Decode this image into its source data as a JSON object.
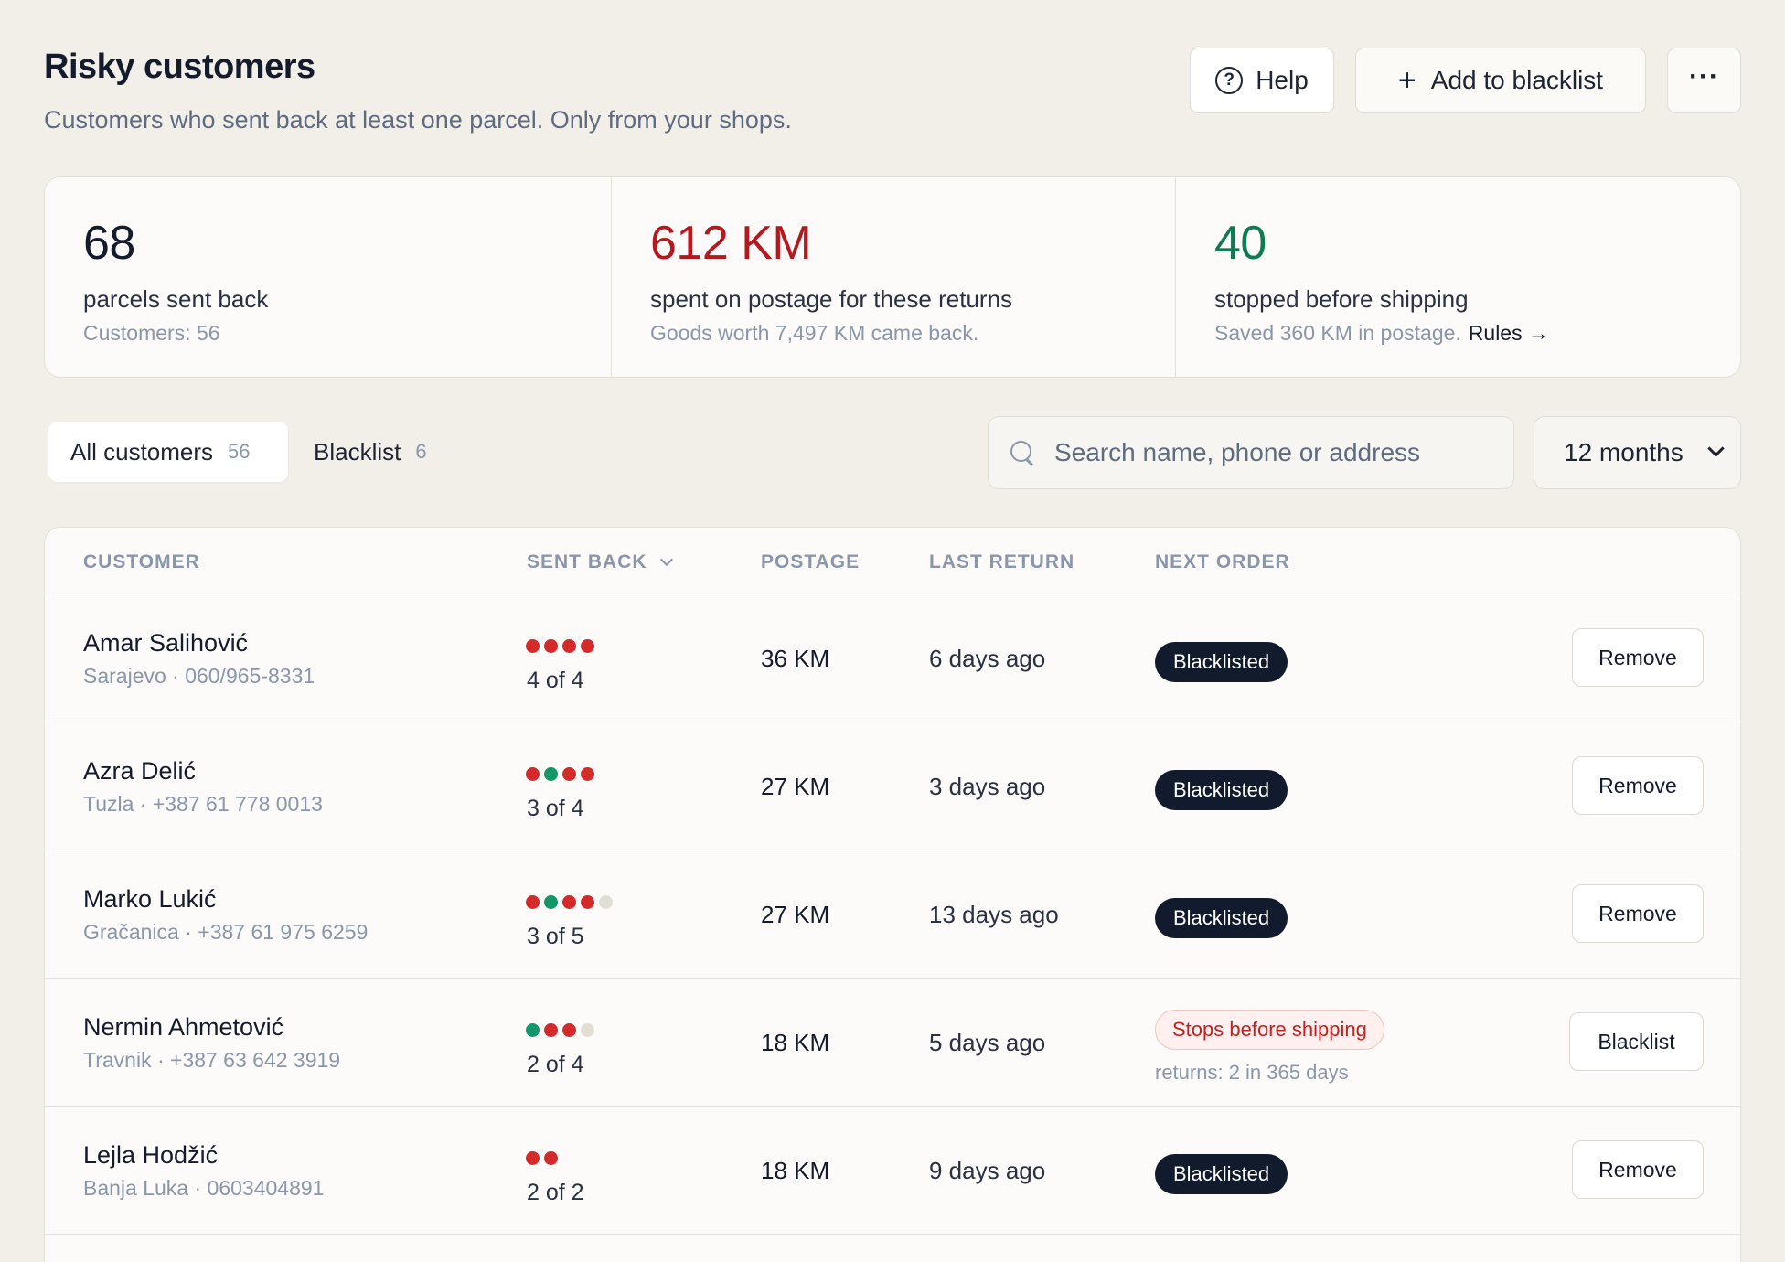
{
  "header": {
    "title": "Risky customers",
    "subtitle": "Customers who sent back at least one parcel. Only from your shops.",
    "help_label": "Help",
    "add_label": "Add to blacklist",
    "more_label": "···"
  },
  "stats": [
    {
      "value": "68",
      "label": "parcels sent back",
      "sub": "Customers: 56",
      "color": "#141b2d"
    },
    {
      "value": "612 KM",
      "label": "spent on postage for these returns",
      "sub": "Goods worth 7,497 KM came back.",
      "color": "#b3191f"
    },
    {
      "value": "40",
      "label": "stopped before shipping",
      "sub": "Saved 360 KM in postage.",
      "link": "Rules →",
      "color": "#0d7a52"
    }
  ],
  "tabs": [
    {
      "label": "All customers",
      "count": "56"
    },
    {
      "label": "Blacklist",
      "count": "6"
    }
  ],
  "search": {
    "placeholder": "Search name, phone or address"
  },
  "period": {
    "selected": "12 months"
  },
  "table": {
    "columns": [
      "CUSTOMER",
      "SENT BACK",
      "POSTAGE",
      "LAST RETURN",
      "NEXT ORDER"
    ],
    "rows": [
      {
        "name": "Amar Salihović",
        "meta": "Sarajevo · 060/965-8331",
        "dots": [
          "red",
          "red",
          "red",
          "red"
        ],
        "fraction": "4 of 4",
        "postage": "36 KM",
        "last_return": "6 days ago",
        "status": "Blacklisted",
        "status_type": "blacklisted",
        "action": "Remove"
      },
      {
        "name": "Azra Delić",
        "meta": "Tuzla · +387 61 778 0013",
        "dots": [
          "red",
          "green",
          "red",
          "red"
        ],
        "fraction": "3 of 4",
        "postage": "27 KM",
        "last_return": "3 days ago",
        "status": "Blacklisted",
        "status_type": "blacklisted",
        "action": "Remove"
      },
      {
        "name": "Marko Lukić",
        "meta": "Gračanica · +387 61 975 6259",
        "dots": [
          "red",
          "green",
          "red",
          "red",
          "grey"
        ],
        "fraction": "3 of 5",
        "postage": "27 KM",
        "last_return": "13 days ago",
        "status": "Blacklisted",
        "status_type": "blacklisted",
        "action": "Remove"
      },
      {
        "name": "Nermin Ahmetović",
        "meta": "Travnik · +387 63 642 3919",
        "dots": [
          "green",
          "red",
          "red",
          "grey"
        ],
        "fraction": "2 of 4",
        "postage": "18 KM",
        "last_return": "5 days ago",
        "status": "Stops before shipping",
        "status_type": "warning",
        "note": "returns: 2 in 365 days",
        "action": "Blacklist"
      },
      {
        "name": "Lejla Hodžić",
        "meta": "Banja Luka · 0603404891",
        "dots": [
          "red",
          "red"
        ],
        "fraction": "2 of 2",
        "postage": "18 KM",
        "last_return": "9 days ago",
        "status": "Blacklisted",
        "status_type": "blacklisted",
        "action": "Remove"
      }
    ]
  }
}
